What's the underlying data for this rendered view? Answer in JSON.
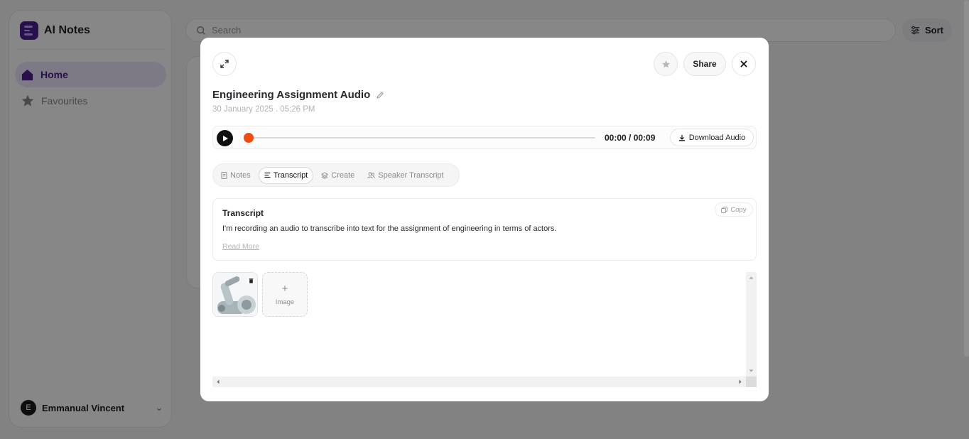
{
  "app": {
    "name": "AI Notes"
  },
  "sidebar": {
    "items": [
      {
        "label": "Home",
        "icon": "home-icon",
        "active": true
      },
      {
        "label": "Favourites",
        "icon": "star-icon",
        "active": false
      }
    ],
    "user": {
      "initial": "E",
      "name": "Emmanual Vincent"
    }
  },
  "header": {
    "search_placeholder": "Search",
    "sort_label": "Sort"
  },
  "modal": {
    "share_label": "Share",
    "title": "Engineering Assignment Audio",
    "date": "30 January 2025 . 05:26 PM",
    "player": {
      "time": "00:00 / 00:09",
      "progress": 0,
      "download_label": "Download Audio"
    },
    "tabs": [
      {
        "label": "Notes",
        "icon": "document-icon",
        "active": false
      },
      {
        "label": "Transcript",
        "icon": "lines-icon",
        "active": true
      },
      {
        "label": "Create",
        "icon": "layers-icon",
        "active": false
      },
      {
        "label": "Speaker Transcript",
        "icon": "users-icon",
        "active": false
      }
    ],
    "transcript": {
      "heading": "Transcript",
      "copy_label": "Copy",
      "text": "I'm recording an audio to transcribe into text for the assignment of engineering in terms of actors.",
      "read_more": "Read More"
    },
    "gallery": {
      "add_plus": "+",
      "add_label": "Image"
    }
  },
  "colors": {
    "brand": "#4b1f8f",
    "accent_orange": "#f24b12",
    "active_nav_bg": "#efe6fb"
  }
}
